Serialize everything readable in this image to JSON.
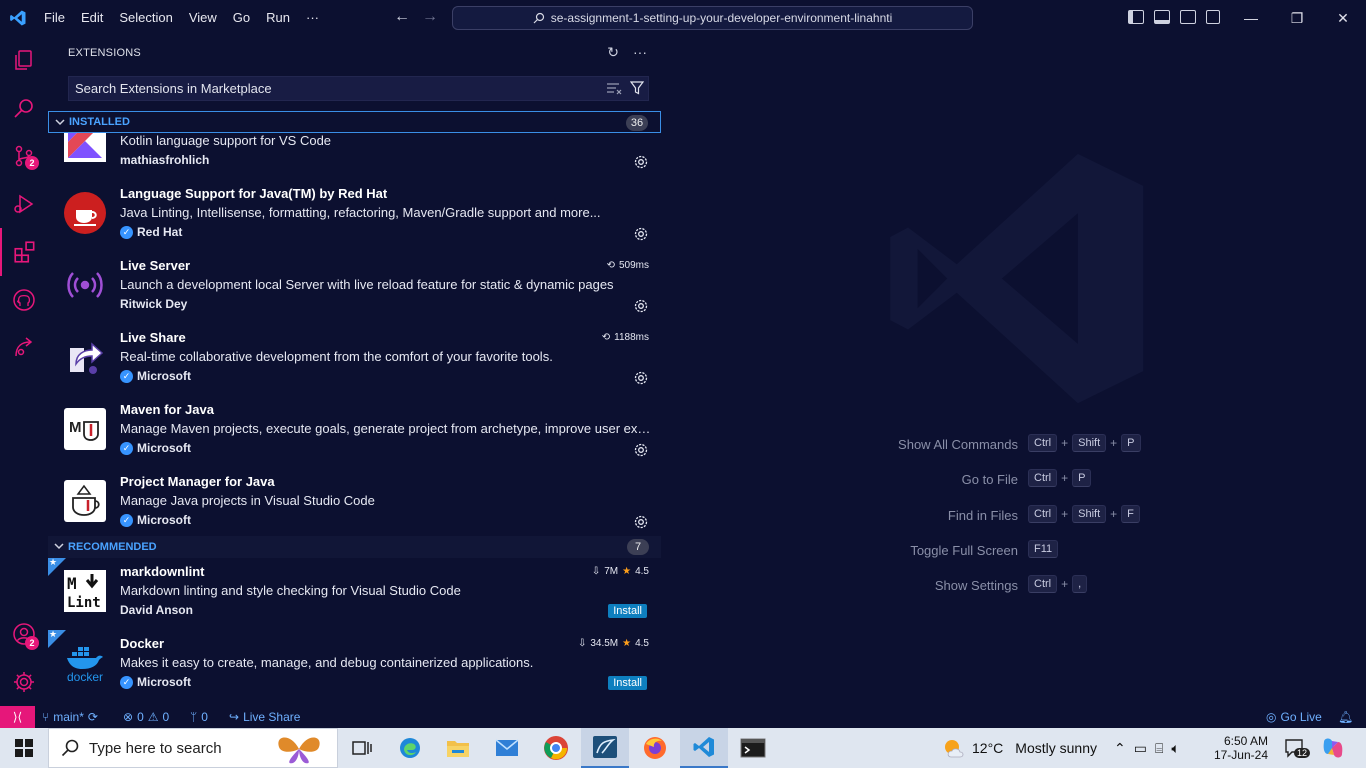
{
  "titlebar": {
    "menu": [
      "File",
      "Edit",
      "Selection",
      "View",
      "Go",
      "Run",
      "···"
    ],
    "command_center": "se-assignment-1-setting-up-your-developer-environment-linahnti"
  },
  "activitybar": {
    "source_control_badge": "2",
    "accounts_badge": "2"
  },
  "sidebar": {
    "title": "EXTENSIONS",
    "search_placeholder": "Search Extensions in Marketplace",
    "installed": {
      "label": "INSTALLED",
      "count": "36",
      "items": [
        {
          "name": "",
          "desc": "Kotlin language support for VS Code",
          "publisher": "mathiasfrohlich",
          "verified": false,
          "meta": ""
        },
        {
          "name": "Language Support for Java(TM) by Red Hat",
          "desc": "Java Linting, Intellisense, formatting, refactoring, Maven/Gradle support and more...",
          "publisher": "Red Hat",
          "verified": true,
          "meta": ""
        },
        {
          "name": "Live Server",
          "desc": "Launch a development local Server with live reload feature for static & dynamic pages",
          "publisher": "Ritwick Dey",
          "verified": false,
          "meta": "509ms"
        },
        {
          "name": "Live Share",
          "desc": "Real-time collaborative development from the comfort of your favorite tools.",
          "publisher": "Microsoft",
          "verified": true,
          "meta": "1188ms"
        },
        {
          "name": "Maven for Java",
          "desc": "Manage Maven projects, execute goals, generate project from archetype, improve user exp...",
          "publisher": "Microsoft",
          "verified": true,
          "meta": ""
        },
        {
          "name": "Project Manager for Java",
          "desc": "Manage Java projects in Visual Studio Code",
          "publisher": "Microsoft",
          "verified": true,
          "meta": ""
        }
      ]
    },
    "recommended": {
      "label": "RECOMMENDED",
      "count": "7",
      "items": [
        {
          "name": "markdownlint",
          "desc": "Markdown linting and style checking for Visual Studio Code",
          "publisher": "David Anson",
          "verified": false,
          "downloads": "7M",
          "rating": "4.5",
          "install_label": "Install"
        },
        {
          "name": "Docker",
          "desc": "Makes it easy to create, manage, and debug containerized applications.",
          "publisher": "Microsoft",
          "verified": true,
          "downloads": "34.5M",
          "rating": "4.5",
          "install_label": "Install",
          "icon_text": "docker"
        }
      ]
    }
  },
  "editor": {
    "shortcuts": [
      {
        "label": "Show All Commands",
        "keys": [
          "Ctrl",
          "Shift",
          "P"
        ]
      },
      {
        "label": "Go to File",
        "keys": [
          "Ctrl",
          "P"
        ]
      },
      {
        "label": "Find in Files",
        "keys": [
          "Ctrl",
          "Shift",
          "F"
        ]
      },
      {
        "label": "Toggle Full Screen",
        "keys": [
          "F11"
        ]
      },
      {
        "label": "Show Settings",
        "keys": [
          "Ctrl",
          ","
        ]
      }
    ]
  },
  "statusbar": {
    "branch": "main*",
    "errors": "0",
    "warnings": "0",
    "ports": "0",
    "live_share": "Live Share",
    "go_live": "Go Live"
  },
  "taskbar": {
    "search_placeholder": "Type here to search",
    "weather_temp": "12°C",
    "weather_text": "Mostly sunny",
    "time": "6:50 AM",
    "date": "17-Jun-24",
    "notifications": "12"
  },
  "colors": {
    "background": "#0c1030",
    "accent": "#e6177a",
    "link_blue": "#4aa3ff",
    "install_blue": "#0e7fbf"
  }
}
